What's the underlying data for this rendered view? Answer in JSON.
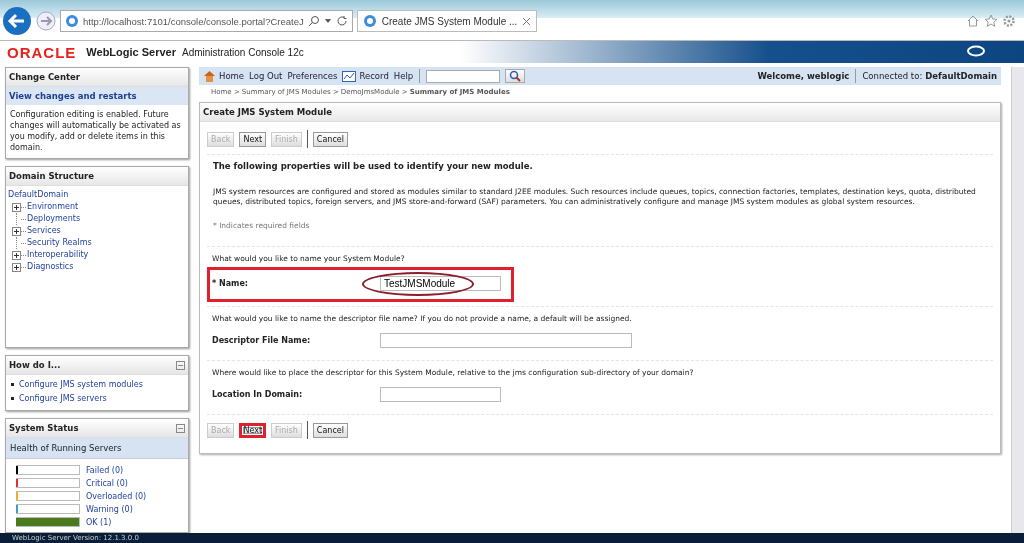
{
  "browser": {
    "address": "http://localhost:7101/console/console.portal?CreateJ",
    "tab_title": "Create JMS System Module ..."
  },
  "header": {
    "brand": "ORACLE",
    "product": "WebLogic Server",
    "subtitle": "Administration Console 12c"
  },
  "toolbar": {
    "links": [
      {
        "label": "Home",
        "kind": "home"
      },
      {
        "label": "Log Out",
        "kind": "text"
      },
      {
        "label": "Preferences",
        "kind": "text"
      },
      {
        "label": "Record",
        "kind": "record"
      },
      {
        "label": "Help",
        "kind": "text"
      }
    ],
    "welcome": "Welcome, weblogic",
    "connected_label": "Connected to:",
    "domain": "DefaultDomain"
  },
  "breadcrumb": [
    {
      "label": "Home >",
      "current": false
    },
    {
      "label": "Summary of JMS Modules >",
      "current": false
    },
    {
      "label": "DemoJmsModule >",
      "current": false
    },
    {
      "label": "Summary of JMS Modules",
      "current": true
    }
  ],
  "change_center": {
    "title": "Change Center",
    "link": "View changes and restarts",
    "text": "Configuration editing is enabled. Future changes will automatically be activated as you modify, add or delete items in this domain."
  },
  "domain_structure": {
    "title": "Domain Structure",
    "root": "DefaultDomain",
    "items": [
      {
        "label": "Environment",
        "kind": "folder"
      },
      {
        "label": "Deployments",
        "kind": "leaf"
      },
      {
        "label": "Services",
        "kind": "folder"
      },
      {
        "label": "Security Realms",
        "kind": "leaf"
      },
      {
        "label": "Interoperability",
        "kind": "folder"
      },
      {
        "label": "Diagnostics",
        "kind": "folder"
      }
    ]
  },
  "how_do_i": {
    "title": "How do I...",
    "links": [
      "Configure JMS system modules",
      "Configure JMS servers"
    ]
  },
  "system_status": {
    "title": "System Status",
    "subtitle": "Health of Running Servers",
    "items": [
      {
        "label": "Failed (0)",
        "color": "#000000",
        "level": 0
      },
      {
        "label": "Critical (0)",
        "color": "#e03030",
        "level": 0
      },
      {
        "label": "Overloaded (0)",
        "color": "#f0b020",
        "level": 0
      },
      {
        "label": "Warning (0)",
        "color": "#40a0c0",
        "level": 0
      },
      {
        "label": "OK (1)",
        "color": "#4a7a1c",
        "level": 1
      }
    ]
  },
  "page": {
    "title": "Create JMS System Module",
    "top_buttons": [
      {
        "label": "Back",
        "disabled": true,
        "highlighted": false
      },
      {
        "label": "Next",
        "disabled": false,
        "highlighted": false
      },
      {
        "label": "Finish",
        "disabled": true,
        "highlighted": false
      },
      {
        "label": "Cancel",
        "disabled": false,
        "highlighted": false
      }
    ],
    "heading": "The following properties will be used to identify your new module.",
    "description": "JMS system resources are configured and stored as modules similar to standard J2EE modules. Such resources include queues, topics, connection factories, templates, destination keys, quota, distributed queues, distributed topics, foreign servers, and JMS store-and-forward (SAF) parameters. You can administratively configure and manage JMS system modules as global system resources.",
    "required_note": "* Indicates required fields",
    "fields": [
      {
        "question": "What would you like to name your System Module?",
        "label": "* Name:",
        "value": "TestJMSModule",
        "highlighted": true,
        "circled": true,
        "wide": false
      },
      {
        "question": "What would you like to name the descriptor file name? If you do not provide a name, a default will be assigned.",
        "label": "Descriptor File Name:",
        "highlighted": false,
        "circled": false,
        "wide": true
      },
      {
        "question": "Where would like to place the descriptor for this System Module, relative to the jms configuration sub-directory of your domain?",
        "label": "Location In Domain:",
        "highlighted": false,
        "circled": false,
        "wide": false
      }
    ],
    "bottom_buttons": [
      {
        "label": "Back",
        "disabled": true,
        "highlighted": false
      },
      {
        "label": "Next",
        "disabled": false,
        "highlighted": true
      },
      {
        "label": "Finish",
        "disabled": true,
        "highlighted": false
      },
      {
        "label": "Cancel",
        "disabled": false,
        "highlighted": false
      }
    ]
  },
  "footer": {
    "version": "WebLogic Server Version: 12.1.3.0.0"
  }
}
